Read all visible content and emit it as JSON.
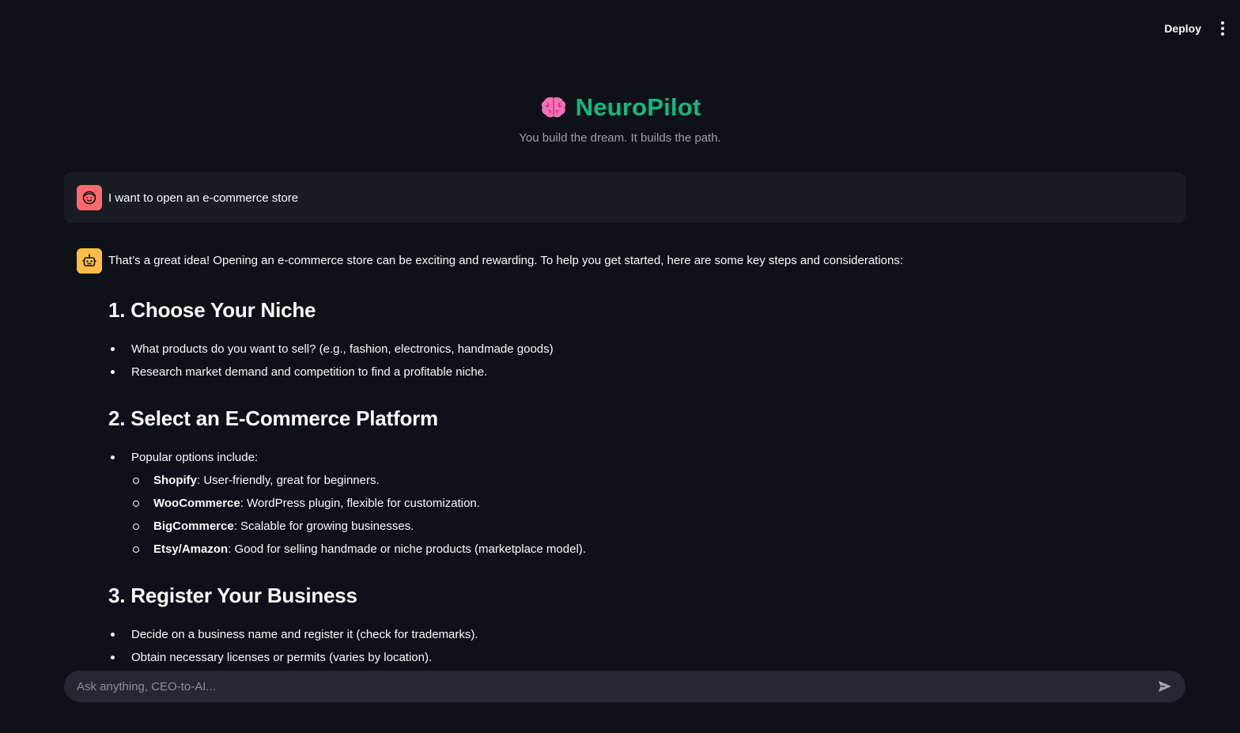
{
  "toolbar": {
    "deploy_label": "Deploy",
    "menu_icon": "more-vertical-icon"
  },
  "header": {
    "icon": "brain-icon",
    "title": "NeuroPilot",
    "tagline": "You build the dream. It builds the path.",
    "title_color": "#10b981"
  },
  "messages": {
    "user": {
      "avatar_icon": "user-face-icon",
      "avatar_color": "#ff6b6b",
      "text": "I want to open an e-commerce store"
    },
    "assistant": {
      "avatar_icon": "robot-icon",
      "avatar_color": "#ffbd45",
      "intro": "That’s a great idea! Opening an e-commerce store can be exciting and rewarding. To help you get started, here are some key steps and considerations:",
      "sections": [
        {
          "heading": "1. Choose Your Niche",
          "items": [
            "What products do you want to sell? (e.g., fashion, electronics, handmade goods)",
            "Research market demand and competition to find a profitable niche."
          ]
        },
        {
          "heading": "2. Select an E-Commerce Platform",
          "items": [
            "Popular options include:"
          ],
          "subitems": [
            {
              "bold": "Shopify",
              "text": ": User-friendly, great for beginners."
            },
            {
              "bold": "WooCommerce",
              "text": ": WordPress plugin, flexible for customization."
            },
            {
              "bold": "BigCommerce",
              "text": ": Scalable for growing businesses."
            },
            {
              "bold": "Etsy/Amazon",
              "text": ": Good for selling handmade or niche products (marketplace model)."
            }
          ]
        },
        {
          "heading": "3. Register Your Business",
          "items": [
            "Decide on a business name and register it (check for trademarks).",
            "Obtain necessary licenses or permits (varies by location)."
          ]
        }
      ]
    }
  },
  "chat_input": {
    "placeholder": "Ask anything, CEO-to-AI...",
    "value": "",
    "send_icon": "send-icon"
  }
}
